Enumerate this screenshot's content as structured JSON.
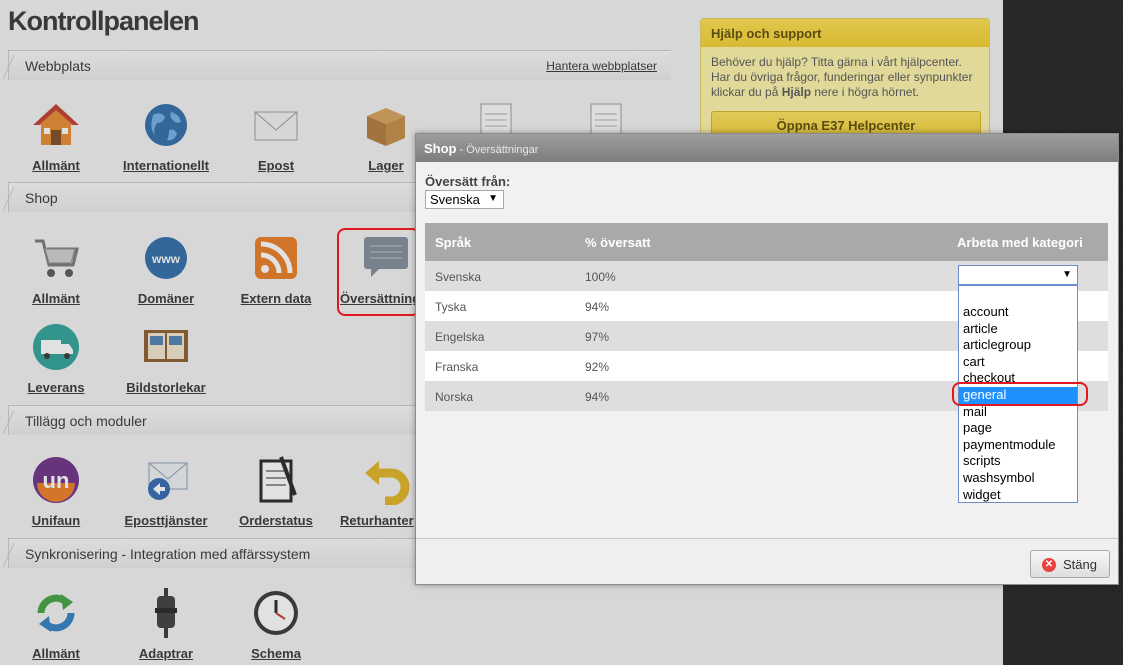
{
  "page": {
    "title": "Kontrollpanelen"
  },
  "sections": {
    "webbplats": {
      "title": "Webbplats",
      "link": "Hantera webbplatser",
      "tiles": [
        "Allmänt",
        "Internationellt",
        "Epost",
        "Lager"
      ]
    },
    "shop": {
      "title": "Shop",
      "tiles": [
        "Allmänt",
        "Domäner",
        "Extern data",
        "Översättning",
        "Leverans",
        "Bildstorlekar"
      ]
    },
    "tillagg": {
      "title": "Tillägg och moduler",
      "tiles": [
        "Unifaun",
        "Eposttjänster",
        "Orderstatus",
        "Returhanter"
      ]
    },
    "synk": {
      "title": "Synkronisering - Integration med affärssystem",
      "tiles": [
        "Allmänt",
        "Adaptrar",
        "Schema"
      ]
    }
  },
  "help": {
    "title": "Hjälp och support",
    "text_1": "Behöver du hjälp? Titta gärna i vårt hjälpcenter.",
    "text_2": "Har du övriga frågor, funderingar eller synpunkter",
    "text_3_pre": "klickar du på ",
    "text_3_bold": "Hjälp",
    "text_3_post": " nere i högra hörnet.",
    "button": "Öppna E37 Helpcenter"
  },
  "modal": {
    "title": "Shop",
    "subtitle": " - Översättningar",
    "from_label": "Översätt från:",
    "from_value": "Svenska",
    "columns": [
      "Språk",
      "% översatt",
      "Arbeta med kategori"
    ],
    "rows": [
      {
        "lang": "Svenska",
        "pct": "100%"
      },
      {
        "lang": "Tyska",
        "pct": "94%"
      },
      {
        "lang": "Engelska",
        "pct": "97%"
      },
      {
        "lang": "Franska",
        "pct": "92%"
      },
      {
        "lang": "Norska",
        "pct": "94%"
      }
    ],
    "category_options": [
      "account",
      "article",
      "articlegroup",
      "cart",
      "checkout",
      "general",
      "mail",
      "page",
      "paymentmodule",
      "scripts",
      "washsymbol",
      "widget"
    ],
    "selected_category": "general",
    "close_button": "Stäng"
  }
}
